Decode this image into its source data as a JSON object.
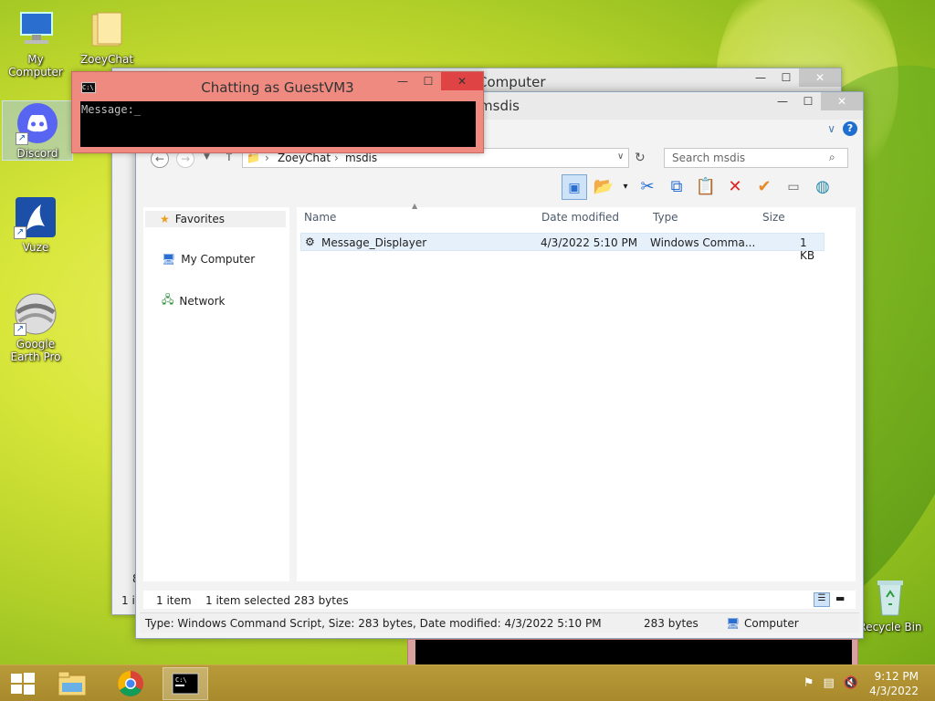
{
  "desktop": {
    "icons": [
      {
        "label": "My Computer"
      },
      {
        "label": "ZoeyChat"
      },
      {
        "label": "Discord"
      },
      {
        "label": "Vuze"
      },
      {
        "label": "Google Earth Pro"
      },
      {
        "label": "Recycle Bin"
      }
    ]
  },
  "back_window": {
    "title": "Computer",
    "status_num": "8",
    "status_text": "1 it"
  },
  "chat_window": {
    "title": "Chatting as GuestVM3",
    "prompt": "Message:",
    "cursor": "_",
    "icon_text": "C:\\"
  },
  "explorer": {
    "title": "msdis",
    "breadcrumb": [
      "ZoeyChat",
      "msdis"
    ],
    "search_placeholder": "Search msdis",
    "nav": [
      {
        "label": "Favorites"
      },
      {
        "label": "My Computer"
      },
      {
        "label": "Network"
      }
    ],
    "columns": [
      "Name",
      "Date modified",
      "Type",
      "Size"
    ],
    "files": [
      {
        "name": "Message_Displayer",
        "date": "4/3/2022 5:10 PM",
        "type": "Windows Comma...",
        "size": "1 KB"
      }
    ],
    "status": {
      "count": "1 item",
      "selected": "1 item selected 283 bytes"
    },
    "details": {
      "text": "Type: Windows Command Script, Size: 283 bytes, Date modified: 4/3/2022 5:10 PM",
      "size": "283 bytes",
      "location": "Computer"
    }
  },
  "taskbar": {
    "clock_time": "9:12 PM",
    "clock_date": "4/3/2022"
  },
  "colors": {
    "chat_accent": "#ee8a80",
    "close_red": "#e04343",
    "taskbar": "#b89a3a"
  }
}
